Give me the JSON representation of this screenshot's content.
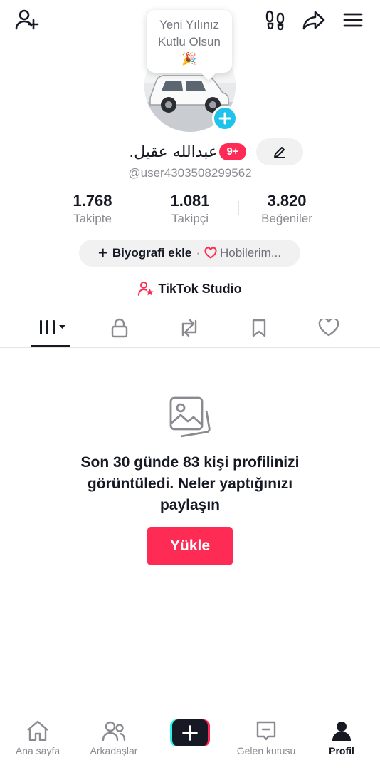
{
  "bubble": {
    "text": "Yeni Yılınız Kutlu Olsun 🎉"
  },
  "profile": {
    "display_name": "عبدالله عقيل.",
    "notification_badge": "9+",
    "username": "@user4303508299562"
  },
  "stats": [
    {
      "value": "1.768",
      "label": "Takipte"
    },
    {
      "value": "1.081",
      "label": "Takipçi"
    },
    {
      "value": "3.820",
      "label": "Beğeniler"
    }
  ],
  "bio": {
    "add_label": "Biyografi ekle",
    "separator": "·",
    "hobby_label": "Hobilerim..."
  },
  "studio": {
    "label": "TikTok Studio"
  },
  "empty_state": {
    "message": "Son 30 günde 83 kişi profilinizi görüntüledi. Neler yaptığınızı paylaşın",
    "upload_label": "Yükle"
  },
  "nav": {
    "home": "Ana sayfa",
    "friends": "Arkadaşlar",
    "inbox": "Gelen kutusu",
    "profile": "Profil"
  },
  "colors": {
    "accent": "#fe2c55",
    "avatar_plus": "#1fc2eb",
    "text": "#161823",
    "muted": "#8a8b91"
  }
}
